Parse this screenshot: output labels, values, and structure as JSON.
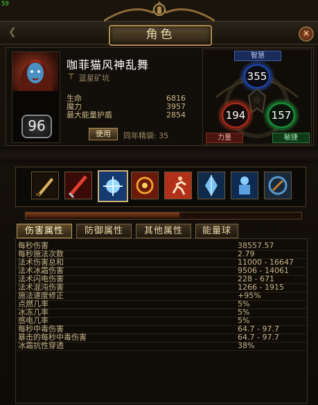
{
  "fps": "59",
  "window": {
    "title": "角色",
    "close_icon": "close-icon"
  },
  "character": {
    "name": "咖菲猫风神乱舞",
    "guild": "蓝星矿坑",
    "level": "96",
    "stats": [
      {
        "label": "生命",
        "value": "6816"
      },
      {
        "label": "魔力",
        "value": "3957"
      },
      {
        "label": "最大能量护盾",
        "value": "2854"
      }
    ],
    "use_button": "使用",
    "league_label": "同年精袋: 35"
  },
  "attributes": {
    "title": "智慧",
    "intelligence": "355",
    "strength": "194",
    "dexterity": "157",
    "strength_label": "力量",
    "dexterity_label": "敏捷"
  },
  "skills": [
    {
      "icon": "dagger-icon",
      "selected": false
    },
    {
      "icon": "bloody-sword-icon",
      "selected": false
    },
    {
      "icon": "ice-nova-icon",
      "selected": true
    },
    {
      "icon": "fire-rune-icon",
      "selected": false
    },
    {
      "icon": "sprint-icon",
      "selected": false
    },
    {
      "icon": "frost-crystal-icon",
      "selected": false
    },
    {
      "icon": "ice-golem-icon",
      "selected": false
    },
    {
      "icon": "shield-rune-icon",
      "selected": false
    }
  ],
  "experience_progress": 0.56,
  "tabs": [
    {
      "label": "伤害属性",
      "active": true
    },
    {
      "label": "防御属性",
      "active": false
    },
    {
      "label": "其他属性",
      "active": false
    },
    {
      "label": "能量球",
      "active": false
    }
  ],
  "damage_stats": [
    {
      "label": "每秒伤害",
      "value": "38557.57"
    },
    {
      "label": "每秒施法次数",
      "value": "2.79"
    },
    {
      "label": "法术伤害总和",
      "value": "11000 - 16647"
    },
    {
      "label": "法术冰霜伤害",
      "value": "9506 - 14061"
    },
    {
      "label": "法术闪电伤害",
      "value": "228 - 671"
    },
    {
      "label": "法术混沌伤害",
      "value": "1266 - 1915"
    },
    {
      "label": "施法速度修正",
      "value": "+95%"
    },
    {
      "label": "点燃几率",
      "value": "5%"
    },
    {
      "label": "冰冻几率",
      "value": "5%"
    },
    {
      "label": "感电几率",
      "value": "5%"
    },
    {
      "label": "每秒中毒伤害",
      "value": "64.7 - 97.7"
    },
    {
      "label": "暴击的每秒中毒伤害",
      "value": "64.7 - 97.7"
    },
    {
      "label": "冰霜抗性穿透",
      "value": "38%"
    }
  ]
}
